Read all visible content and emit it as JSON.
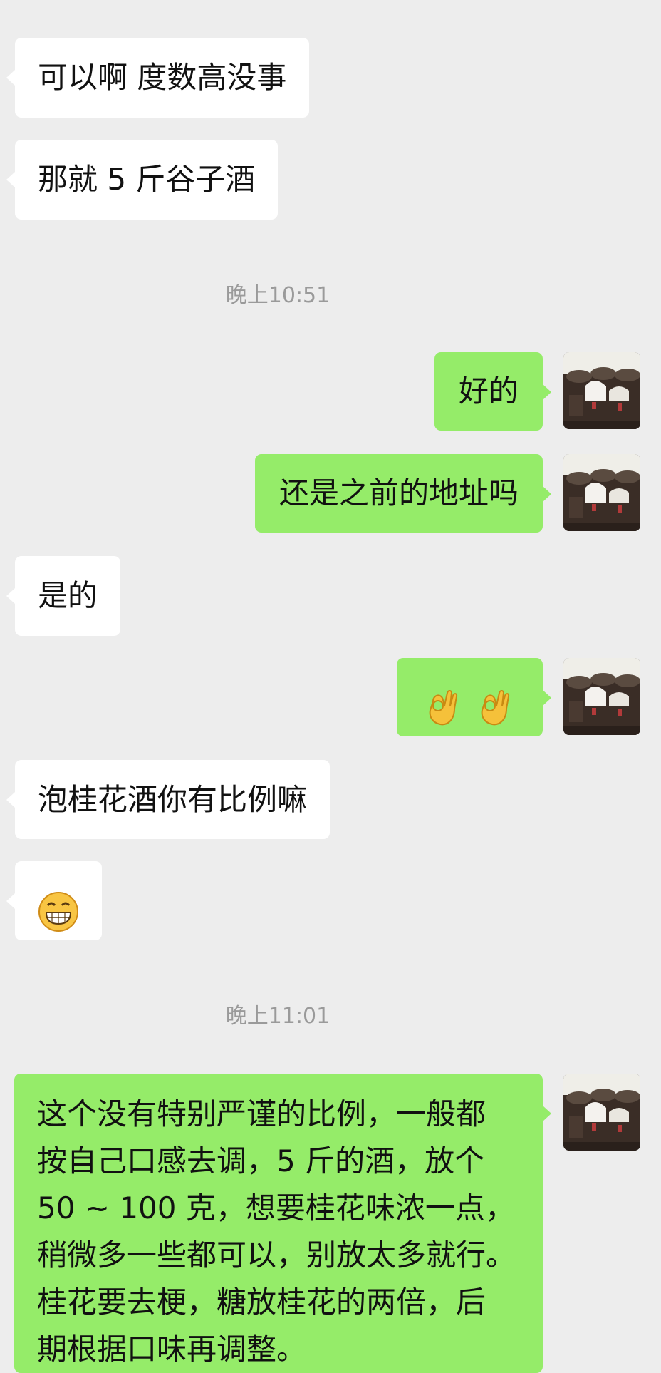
{
  "messages": [
    {
      "side": "left",
      "text": "可以啊 度数高没事"
    },
    {
      "side": "left",
      "text": "那就 5 斤谷子酒"
    },
    {
      "type": "time",
      "text": "晚上10:51"
    },
    {
      "side": "right",
      "text": "好的"
    },
    {
      "side": "right",
      "text": "还是之前的地址吗"
    },
    {
      "side": "left",
      "text": "是的"
    },
    {
      "side": "right",
      "emoji": [
        "ok-hand-icon",
        "ok-hand-icon"
      ]
    },
    {
      "side": "left",
      "text": "泡桂花酒你有比例嘛"
    },
    {
      "side": "left",
      "emoji": [
        "grinning-face-icon"
      ]
    },
    {
      "type": "time",
      "text": "晚上11:01"
    },
    {
      "side": "right",
      "lines": [
        "这个没有特别严谨的比例，一般都",
        "按自己口感去调，5 斤的酒，放个",
        "50 ~ 100 克，想要桂花味浓一点，",
        "稍微多一些都可以，别放太多就行。",
        "桂花要去梗，糖放桂花的两倍，后",
        "期根据口味再调整。"
      ]
    }
  ],
  "colors": {
    "background": "#ededed",
    "left_bubble": "#ffffff",
    "right_bubble": "#95ec69",
    "timestamp": "#9a9a9a",
    "text": "#111111"
  }
}
